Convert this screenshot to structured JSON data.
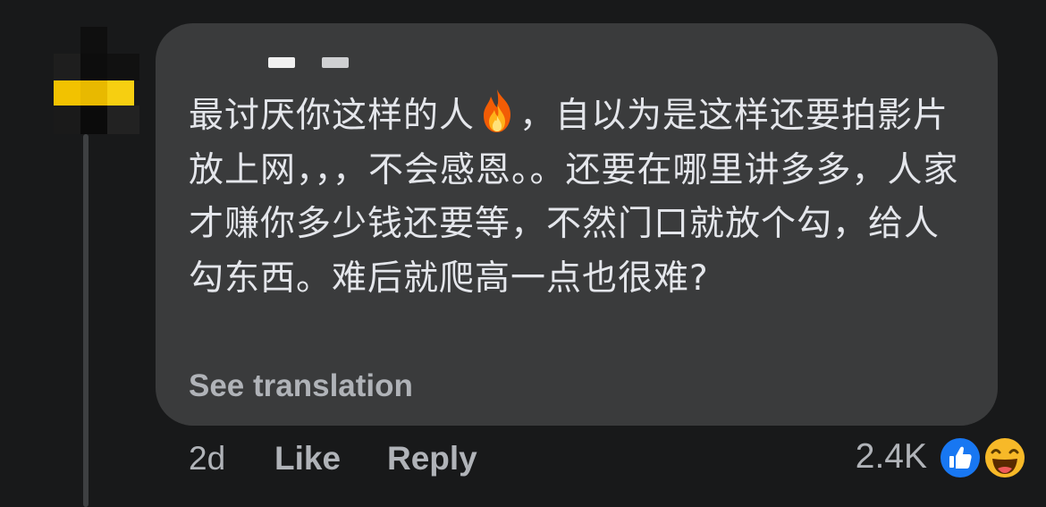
{
  "comment": {
    "line1_before_icon": "最讨厌你这样的人",
    "reaction_icon_inline": "fire-icon",
    "line1_after_icon": "，自以为是这样还要拍影片放上网，，，不会感恩。。还要在哪里讲多多，人家才赚你多少钱还要等，不然门口就放个勾，给人勾东西。难后就爬高一点也很难?",
    "see_translation": "See translation"
  },
  "meta": {
    "time": "2d",
    "like_label": "Like",
    "reply_label": "Reply"
  },
  "reactions": {
    "count": "2.4K",
    "icons": [
      "like-icon",
      "haha-icon"
    ],
    "like_color": "#1877f2",
    "haha_color": "#f7b928"
  },
  "colors": {
    "background": "#18191a",
    "bubble": "#3a3b3c",
    "text": "#e4e6eb",
    "secondary_text": "#b0b3b8"
  }
}
